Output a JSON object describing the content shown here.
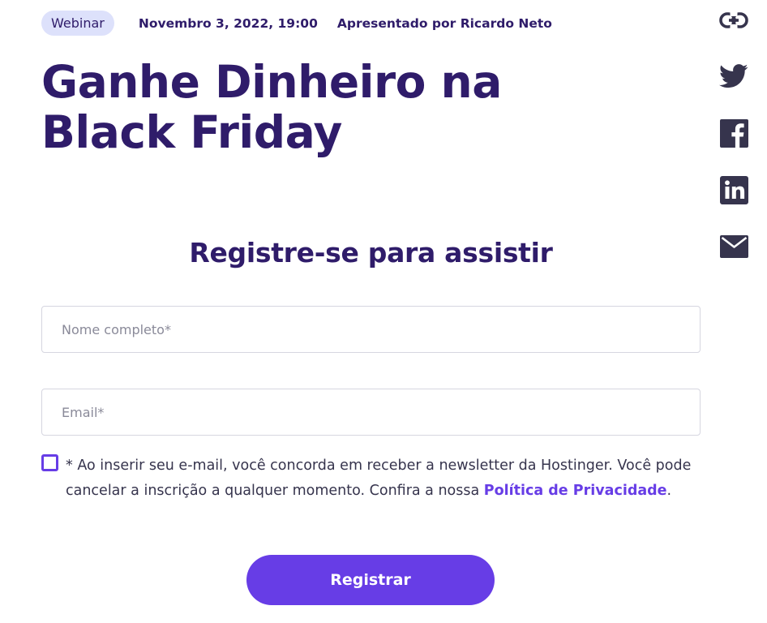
{
  "meta": {
    "badge": "Webinar",
    "date": "Novembro 3, 2022, 19:00",
    "presenter": "Apresentado por Ricardo Neto"
  },
  "title": "Ganhe Dinheiro na Black Friday",
  "share": {
    "icons": [
      "link-icon",
      "twitter-icon",
      "facebook-icon",
      "linkedin-icon",
      "email-icon"
    ],
    "color": "#36344d"
  },
  "form": {
    "heading": "Registre-se para assistir",
    "name_placeholder": "Nome completo*",
    "email_placeholder": "Email*",
    "consent_text": "* Ao inserir seu e-mail, você concorda em receber a newsletter da Hostinger. Você pode cancelar a inscrição a qualquer momento. Confira a nossa ",
    "consent_link": "Política de Privacidade",
    "consent_end": ".",
    "submit_label": "Registrar"
  },
  "colors": {
    "primary": "#673de6",
    "heading": "#2f1c6a",
    "badge_bg": "#dde1fb",
    "text": "#36344d"
  }
}
